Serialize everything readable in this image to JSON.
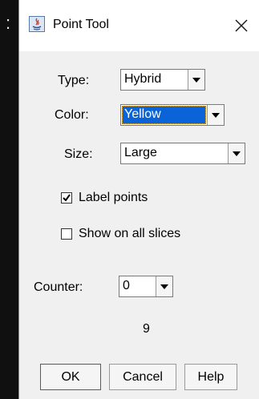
{
  "background": {
    "text": ":"
  },
  "window": {
    "title": "Point Tool",
    "app_icon": "java-icon",
    "close_icon": "close-icon"
  },
  "form": {
    "type": {
      "label": "Type:",
      "value": "Hybrid"
    },
    "color": {
      "label": "Color:",
      "value": "Yellow"
    },
    "size": {
      "label": "Size:",
      "value": "Large"
    },
    "label_points": {
      "label": "Label points",
      "checked": true
    },
    "show_all_slices": {
      "label": "Show on all slices",
      "checked": false
    },
    "counter": {
      "label": "Counter:",
      "value": "0"
    },
    "count_value": "9"
  },
  "buttons": {
    "ok": "OK",
    "cancel": "Cancel",
    "help": "Help"
  }
}
